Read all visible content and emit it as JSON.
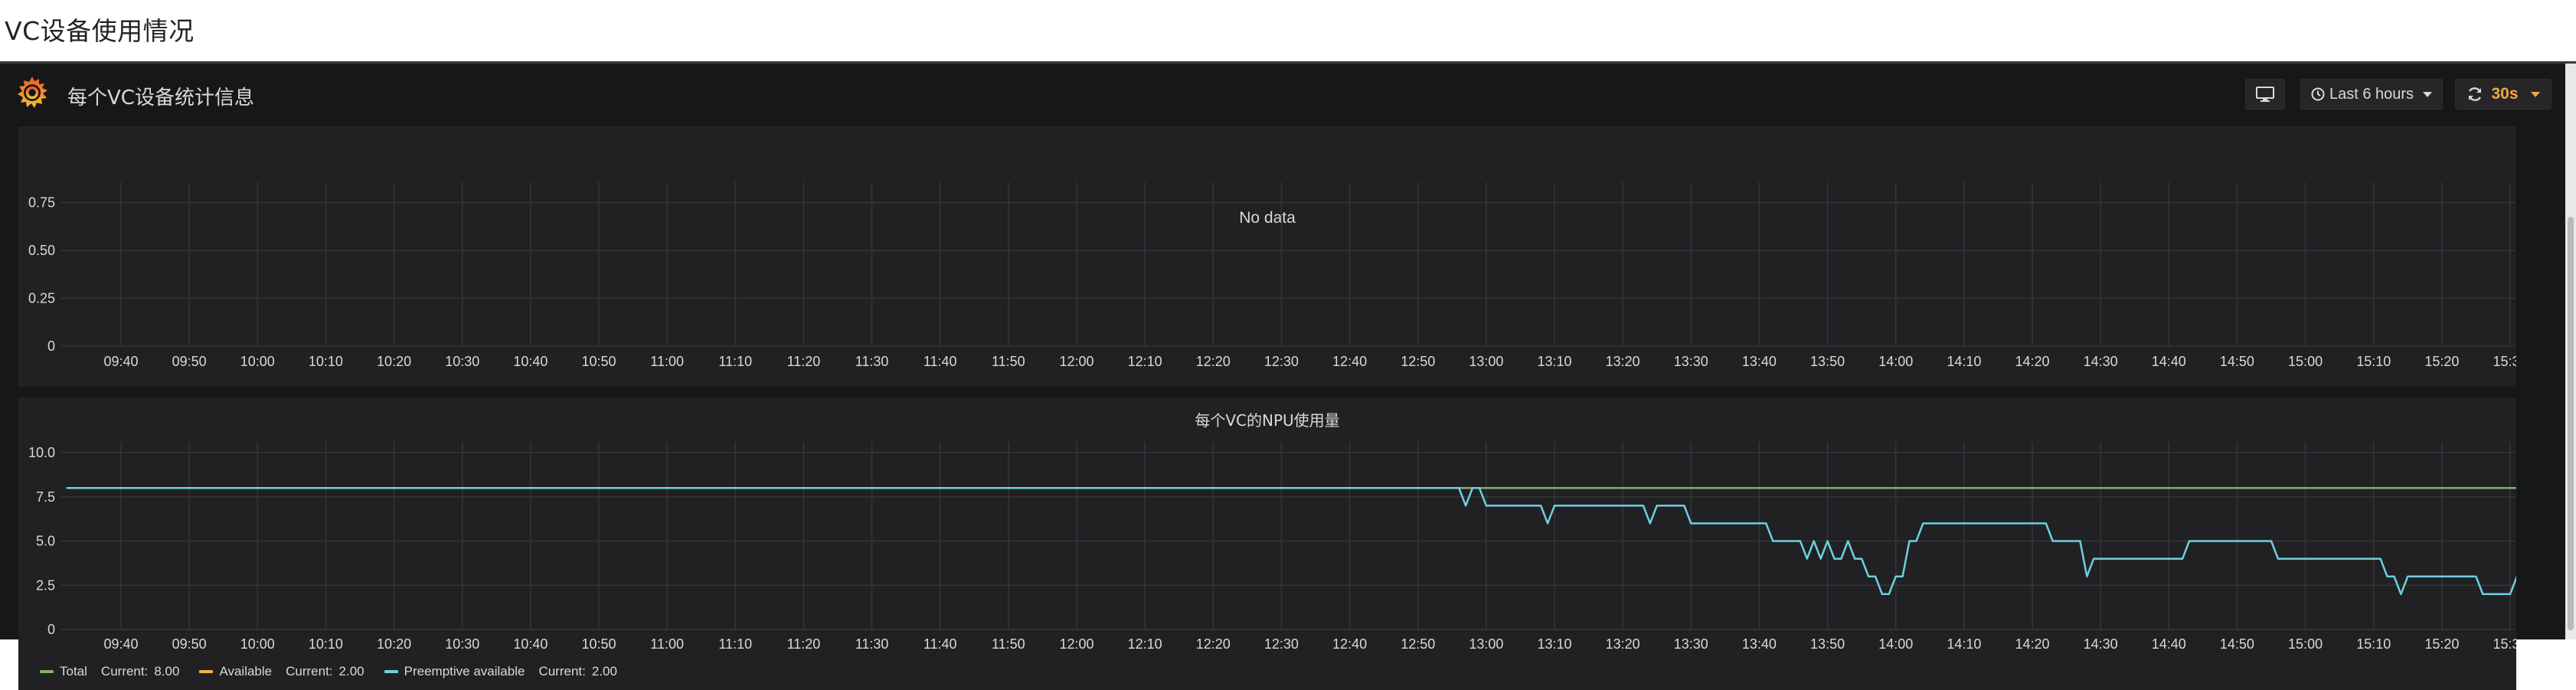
{
  "page": {
    "title": "VC设备使用情况"
  },
  "navbar": {
    "dashboard_title": "每个VC设备统计信息",
    "time_range": "Last 6 hours",
    "refresh_interval": "30s",
    "icons": [
      "grafana-logo-icon",
      "tv-icon",
      "clock-icon",
      "refresh-icon",
      "caret-down-icon"
    ]
  },
  "colors": {
    "background": "#161719",
    "panel": "#212124",
    "grid": "#35363a",
    "text": "#d8d9da",
    "total": "#7eb26d",
    "available": "#eab839",
    "preemptive": "#6ed0e0",
    "refresh_accent": "#f4a742"
  },
  "panels": [
    {
      "title": "",
      "no_data_label": "No data"
    },
    {
      "title": "每个VC的NPU使用量",
      "legend": [
        {
          "name": "Total",
          "current_label": "Current:",
          "current_value": "8.00",
          "color": "#7eb26d"
        },
        {
          "name": "Available",
          "current_label": "Current:",
          "current_value": "2.00",
          "color": "#eab839"
        },
        {
          "name": "Preemptive available",
          "current_label": "Current:",
          "current_value": "2.00",
          "color": "#6ed0e0"
        }
      ]
    }
  ],
  "chart_data": [
    {
      "type": "line",
      "title": "",
      "no_data": true,
      "y_ticks": [
        "0",
        "0.25",
        "0.50",
        "0.75"
      ],
      "ylim": [
        0,
        0.8
      ],
      "x_ticks": [
        "09:40",
        "09:50",
        "10:00",
        "10:10",
        "10:20",
        "10:30",
        "10:40",
        "10:50",
        "11:00",
        "11:10",
        "11:20",
        "11:30",
        "11:40",
        "11:50",
        "12:00",
        "12:10",
        "12:20",
        "12:30",
        "12:40",
        "12:50",
        "13:00",
        "13:10",
        "13:20",
        "13:30",
        "13:40",
        "13:50",
        "14:00",
        "14:10",
        "14:20",
        "14:30",
        "14:40",
        "14:50",
        "15:00",
        "15:10",
        "15:20",
        "15:30"
      ],
      "grid": true,
      "series": []
    },
    {
      "type": "line",
      "title": "每个VC的NPU使用量",
      "y_ticks": [
        "0",
        "2.5",
        "5.0",
        "7.5",
        "10.0"
      ],
      "ylim": [
        0,
        10
      ],
      "x_ticks": [
        "09:40",
        "09:50",
        "10:00",
        "10:10",
        "10:20",
        "10:30",
        "10:40",
        "10:50",
        "11:00",
        "11:10",
        "11:20",
        "11:30",
        "11:40",
        "11:50",
        "12:00",
        "12:10",
        "12:20",
        "12:30",
        "12:40",
        "12:50",
        "13:00",
        "13:10",
        "13:20",
        "13:30",
        "13:40",
        "13:50",
        "14:00",
        "14:10",
        "14:20",
        "14:30",
        "14:40",
        "14:50",
        "15:00",
        "15:10",
        "15:20",
        "15:30"
      ],
      "xlim": [
        "09:32",
        "15:31"
      ],
      "grid": true,
      "legend_position": "bottom-left",
      "series": [
        {
          "name": "Total",
          "color": "#7eb26d",
          "points": [
            [
              "09:32",
              8
            ],
            [
              "15:31",
              8
            ]
          ]
        },
        {
          "name": "Preemptive available",
          "color": "#6ed0e0",
          "points": [
            [
              "09:32",
              8
            ],
            [
              "12:56",
              8
            ],
            [
              "12:57",
              7
            ],
            [
              "12:58",
              8
            ],
            [
              "12:59",
              8
            ],
            [
              "13:00",
              7
            ],
            [
              "13:08",
              7
            ],
            [
              "13:09",
              6
            ],
            [
              "13:10",
              7
            ],
            [
              "13:23",
              7
            ],
            [
              "13:24",
              6
            ],
            [
              "13:25",
              7
            ],
            [
              "13:29",
              7
            ],
            [
              "13:30",
              6
            ],
            [
              "13:41",
              6
            ],
            [
              "13:42",
              5
            ],
            [
              "13:46",
              5
            ],
            [
              "13:47",
              4
            ],
            [
              "13:48",
              5
            ],
            [
              "13:49",
              4
            ],
            [
              "13:50",
              5
            ],
            [
              "13:51",
              4
            ],
            [
              "13:52",
              4
            ],
            [
              "13:53",
              5
            ],
            [
              "13:54",
              4
            ],
            [
              "13:55",
              4
            ],
            [
              "13:56",
              3
            ],
            [
              "13:57",
              3
            ],
            [
              "13:58",
              2
            ],
            [
              "13:59",
              2
            ],
            [
              "14:00",
              3
            ],
            [
              "14:01",
              3
            ],
            [
              "14:02",
              5
            ],
            [
              "14:03",
              5
            ],
            [
              "14:04",
              6
            ],
            [
              "14:22",
              6
            ],
            [
              "14:23",
              5
            ],
            [
              "14:27",
              5
            ],
            [
              "14:28",
              3
            ],
            [
              "14:29",
              4
            ],
            [
              "14:42",
              4
            ],
            [
              "14:43",
              5
            ],
            [
              "14:55",
              5
            ],
            [
              "14:56",
              4
            ],
            [
              "15:11",
              4
            ],
            [
              "15:12",
              3
            ],
            [
              "15:13",
              3
            ],
            [
              "15:14",
              2
            ],
            [
              "15:15",
              3
            ],
            [
              "15:25",
              3
            ],
            [
              "15:26",
              2
            ],
            [
              "15:30",
              2
            ],
            [
              "15:31",
              3
            ],
            [
              "15:32",
              2
            ]
          ]
        }
      ]
    }
  ]
}
